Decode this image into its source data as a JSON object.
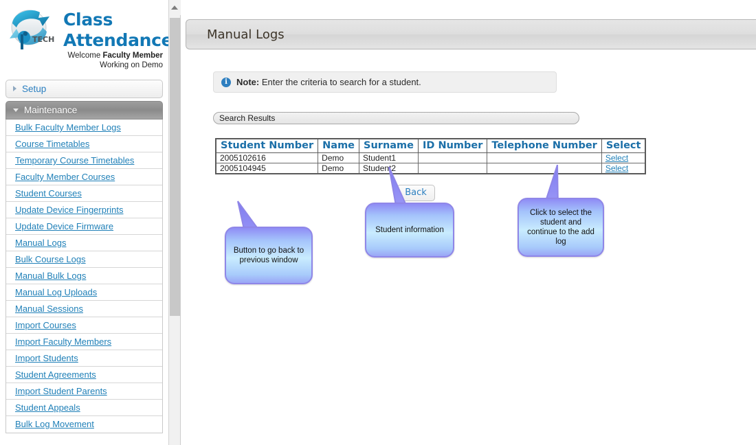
{
  "brand": {
    "logo_icon": "globe-arrows-iptech-logo",
    "title_line1": "Class",
    "title_line2": "Attendance",
    "welcome_prefix": "Welcome ",
    "welcome_user": "Faculty Member",
    "working_on": "Working on Demo"
  },
  "sidebar": {
    "sections": [
      {
        "label": "Setup",
        "expanded": false,
        "arrow_icon": "chevron-right-icon"
      },
      {
        "label": "Maintenance",
        "expanded": true,
        "arrow_icon": "chevron-down-icon"
      }
    ],
    "items": [
      {
        "label": "Bulk Faculty Member Logs"
      },
      {
        "label": "Course Timetables"
      },
      {
        "label": "Temporary Course Timetables"
      },
      {
        "label": "Faculty Member Courses"
      },
      {
        "label": "Student Courses"
      },
      {
        "label": "Update Device Fingerprints"
      },
      {
        "label": "Update Device Firmware"
      },
      {
        "label": "Manual Logs"
      },
      {
        "label": "Bulk Course Logs"
      },
      {
        "label": "Manual Bulk Logs"
      },
      {
        "label": "Manual Log Uploads"
      },
      {
        "label": "Manual Sessions"
      },
      {
        "label": "Import Courses"
      },
      {
        "label": "Import Faculty Members"
      },
      {
        "label": "Import Students"
      },
      {
        "label": "Student Agreements"
      },
      {
        "label": "Import Student Parents"
      },
      {
        "label": "Student Appeals"
      },
      {
        "label": "Bulk Log Movement"
      }
    ],
    "scrollbar": {
      "up_arrow_icon": "chevron-up-icon"
    }
  },
  "header": {
    "title": "Manual Logs"
  },
  "note": {
    "icon": "info-circle-icon",
    "icon_glyph": "i",
    "label": "Note:",
    "text": " Enter the criteria to search for a student."
  },
  "results": {
    "section_label": "Search Results",
    "columns": [
      "Student Number",
      "Name",
      "Surname",
      "ID Number",
      "Telephone Number",
      "Select"
    ],
    "rows": [
      {
        "student_number": "2005102616",
        "name": "Demo",
        "surname": "Student1",
        "id_number": "",
        "telephone_number": "",
        "select": "Select"
      },
      {
        "student_number": "2005104945",
        "name": "Demo",
        "surname": "Student2",
        "id_number": "",
        "telephone_number": "",
        "select": "Select"
      }
    ]
  },
  "buttons": {
    "back": "Back"
  },
  "callouts": [
    {
      "text": "Button to go back to previous window"
    },
    {
      "text": "Student information"
    },
    {
      "text": "Click to select the student and continue to the add log"
    }
  ],
  "colors": {
    "accent_blue": "#2080b8",
    "brand_blue": "#1278b5",
    "callout_fill": "#a9d6fb",
    "callout_border": "#8f86e8",
    "header_title": "#3c3428",
    "table_border": "#5a5a5a"
  }
}
